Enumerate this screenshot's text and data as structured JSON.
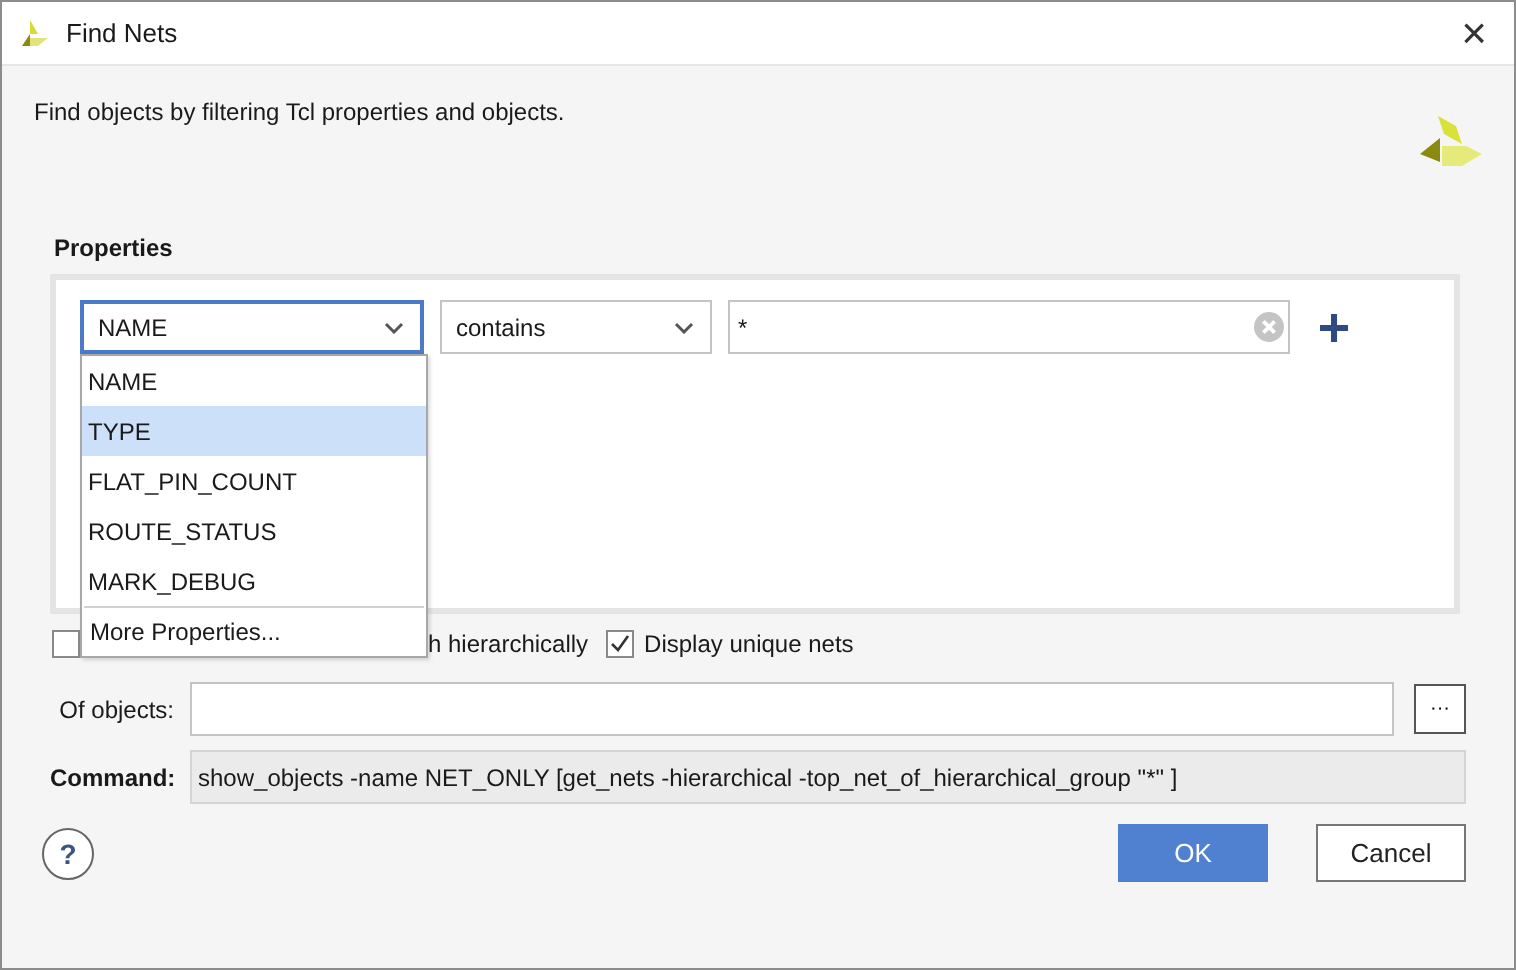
{
  "window": {
    "title": "Find Nets",
    "close": "×"
  },
  "description": "Find objects by filtering Tcl properties and objects.",
  "properties": {
    "title": "Properties",
    "filter": {
      "property": "NAME",
      "operator": "contains",
      "value": "*"
    },
    "dropdown": {
      "items": [
        {
          "label": "NAME",
          "selected": false
        },
        {
          "label": "TYPE",
          "selected": true
        },
        {
          "label": "FLAT_PIN_COUNT",
          "selected": false
        },
        {
          "label": "ROUTE_STATUS",
          "selected": false
        },
        {
          "label": "MARK_DEBUG",
          "selected": false
        }
      ],
      "more": "More Properties..."
    }
  },
  "options": [
    {
      "kind": "hidden",
      "checked": false
    },
    {
      "kind": "partial",
      "label": "h hierarchically"
    },
    {
      "kind": "full",
      "checked": true,
      "label": "Display unique nets"
    }
  ],
  "of_objects": {
    "label": "Of objects:",
    "browse": "···"
  },
  "command": {
    "label": "Command:",
    "value": "show_objects -name NET_ONLY [get_nets -hierarchical -top_net_of_hierarchical_group \"*\" ]"
  },
  "help": "?",
  "buttons": [
    {
      "kind": "primary",
      "label": "OK"
    },
    {
      "kind": "secondary",
      "label": "Cancel"
    }
  ]
}
